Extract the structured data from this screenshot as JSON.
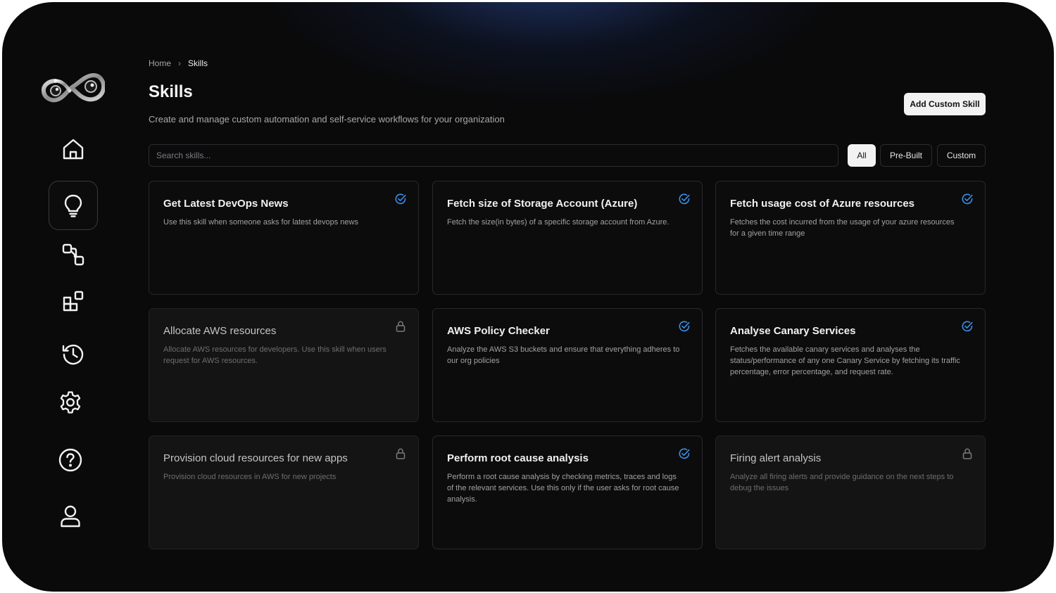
{
  "breadcrumb": {
    "home": "Home",
    "separator": "›",
    "current": "Skills"
  },
  "page": {
    "title": "Skills",
    "subtitle": "Create and manage custom automation and self-service workflows for your organization",
    "add_button": "Add Custom Skill"
  },
  "search": {
    "placeholder": "Search skills..."
  },
  "filters": [
    "All",
    "Pre-Built",
    "Custom"
  ],
  "active_filter": "All",
  "sidebar": {
    "items": [
      {
        "icon": "home-icon"
      },
      {
        "icon": "lightbulb-icon",
        "active": true
      },
      {
        "icon": "workflow-icon"
      },
      {
        "icon": "apps-icon"
      },
      {
        "icon": "history-icon"
      },
      {
        "icon": "gear-icon"
      },
      {
        "icon": "help-icon"
      },
      {
        "icon": "user-icon"
      }
    ]
  },
  "cards": [
    {
      "title": "Get Latest DevOps News",
      "description": "Use this skill when someone asks for latest devops news",
      "status": "enabled"
    },
    {
      "title": "Fetch size of Storage Account (Azure)",
      "description": "Fetch the size(in bytes) of a specific storage account from Azure.",
      "status": "enabled"
    },
    {
      "title": "Fetch usage cost of Azure resources",
      "description": "Fetches the cost incurred from the usage of your azure resources for a given time range",
      "status": "enabled"
    },
    {
      "title": "Allocate AWS resources",
      "description": "Allocate AWS resources for developers. Use this skill when users request for AWS resources.",
      "status": "locked"
    },
    {
      "title": "AWS Policy Checker",
      "description": "Analyze the AWS S3 buckets and ensure that everything adheres to our org policies",
      "status": "enabled"
    },
    {
      "title": "Analyse Canary Services",
      "description": "Fetches the available canary services and analyses the status/performance of any one Canary Service by fetching its traffic percentage, error percentage, and request rate.",
      "status": "enabled"
    },
    {
      "title": "Provision cloud resources for new apps",
      "description": "Provision cloud resources in AWS for new projects",
      "status": "locked"
    },
    {
      "title": "Perform root cause analysis",
      "description": "Perform a root cause analysis by checking metrics, traces and logs of the relevant services. Use this only if the user asks for root cause analysis.",
      "status": "enabled"
    },
    {
      "title": "Firing alert analysis",
      "description": "Analyze all firing alerts and provide guidance on the next steps to debug the issues",
      "status": "locked"
    }
  ],
  "colors": {
    "background": "#0a0a0b",
    "accent_check": "#3b8ee8",
    "glow": "#2c4fa8"
  }
}
